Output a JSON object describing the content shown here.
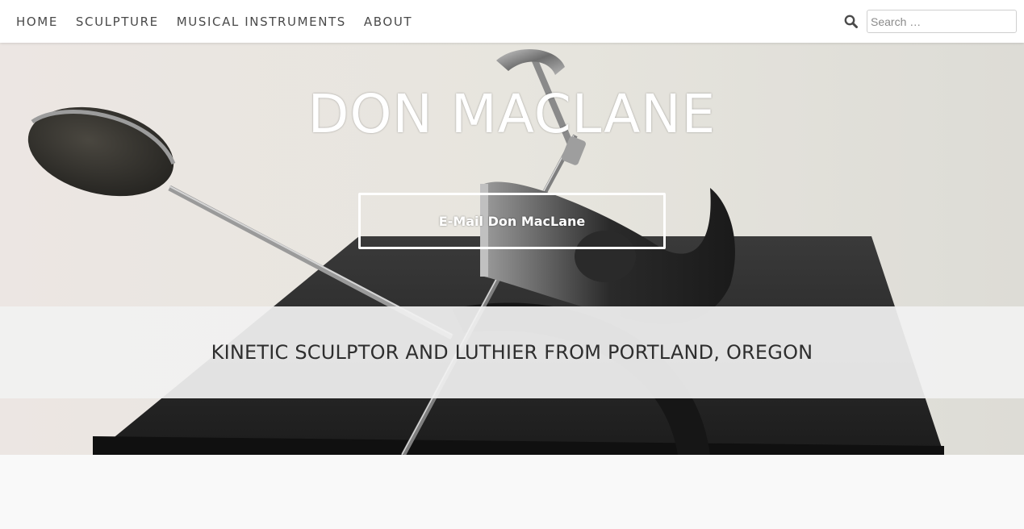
{
  "nav": {
    "items": [
      {
        "label": "HOME"
      },
      {
        "label": "SCULPTURE"
      },
      {
        "label": "MUSICAL INSTRUMENTS"
      },
      {
        "label": "ABOUT"
      }
    ]
  },
  "search": {
    "icon": "search-icon",
    "placeholder": "Search …",
    "value": ""
  },
  "hero": {
    "title": "DON MACLANE",
    "button_label": "E-Mail Don MacLane",
    "tagline": "KINETIC SCULPTOR AND LUTHIER FROM PORTLAND, OREGON"
  },
  "colors": {
    "nav_text": "#4a4a4a",
    "header_bg": "#ffffff",
    "hero_text": "#ffffff",
    "band_bg": "#f1f1f1",
    "tagline_text": "#2e2e2e",
    "page_bg": "#f9f9f9"
  }
}
